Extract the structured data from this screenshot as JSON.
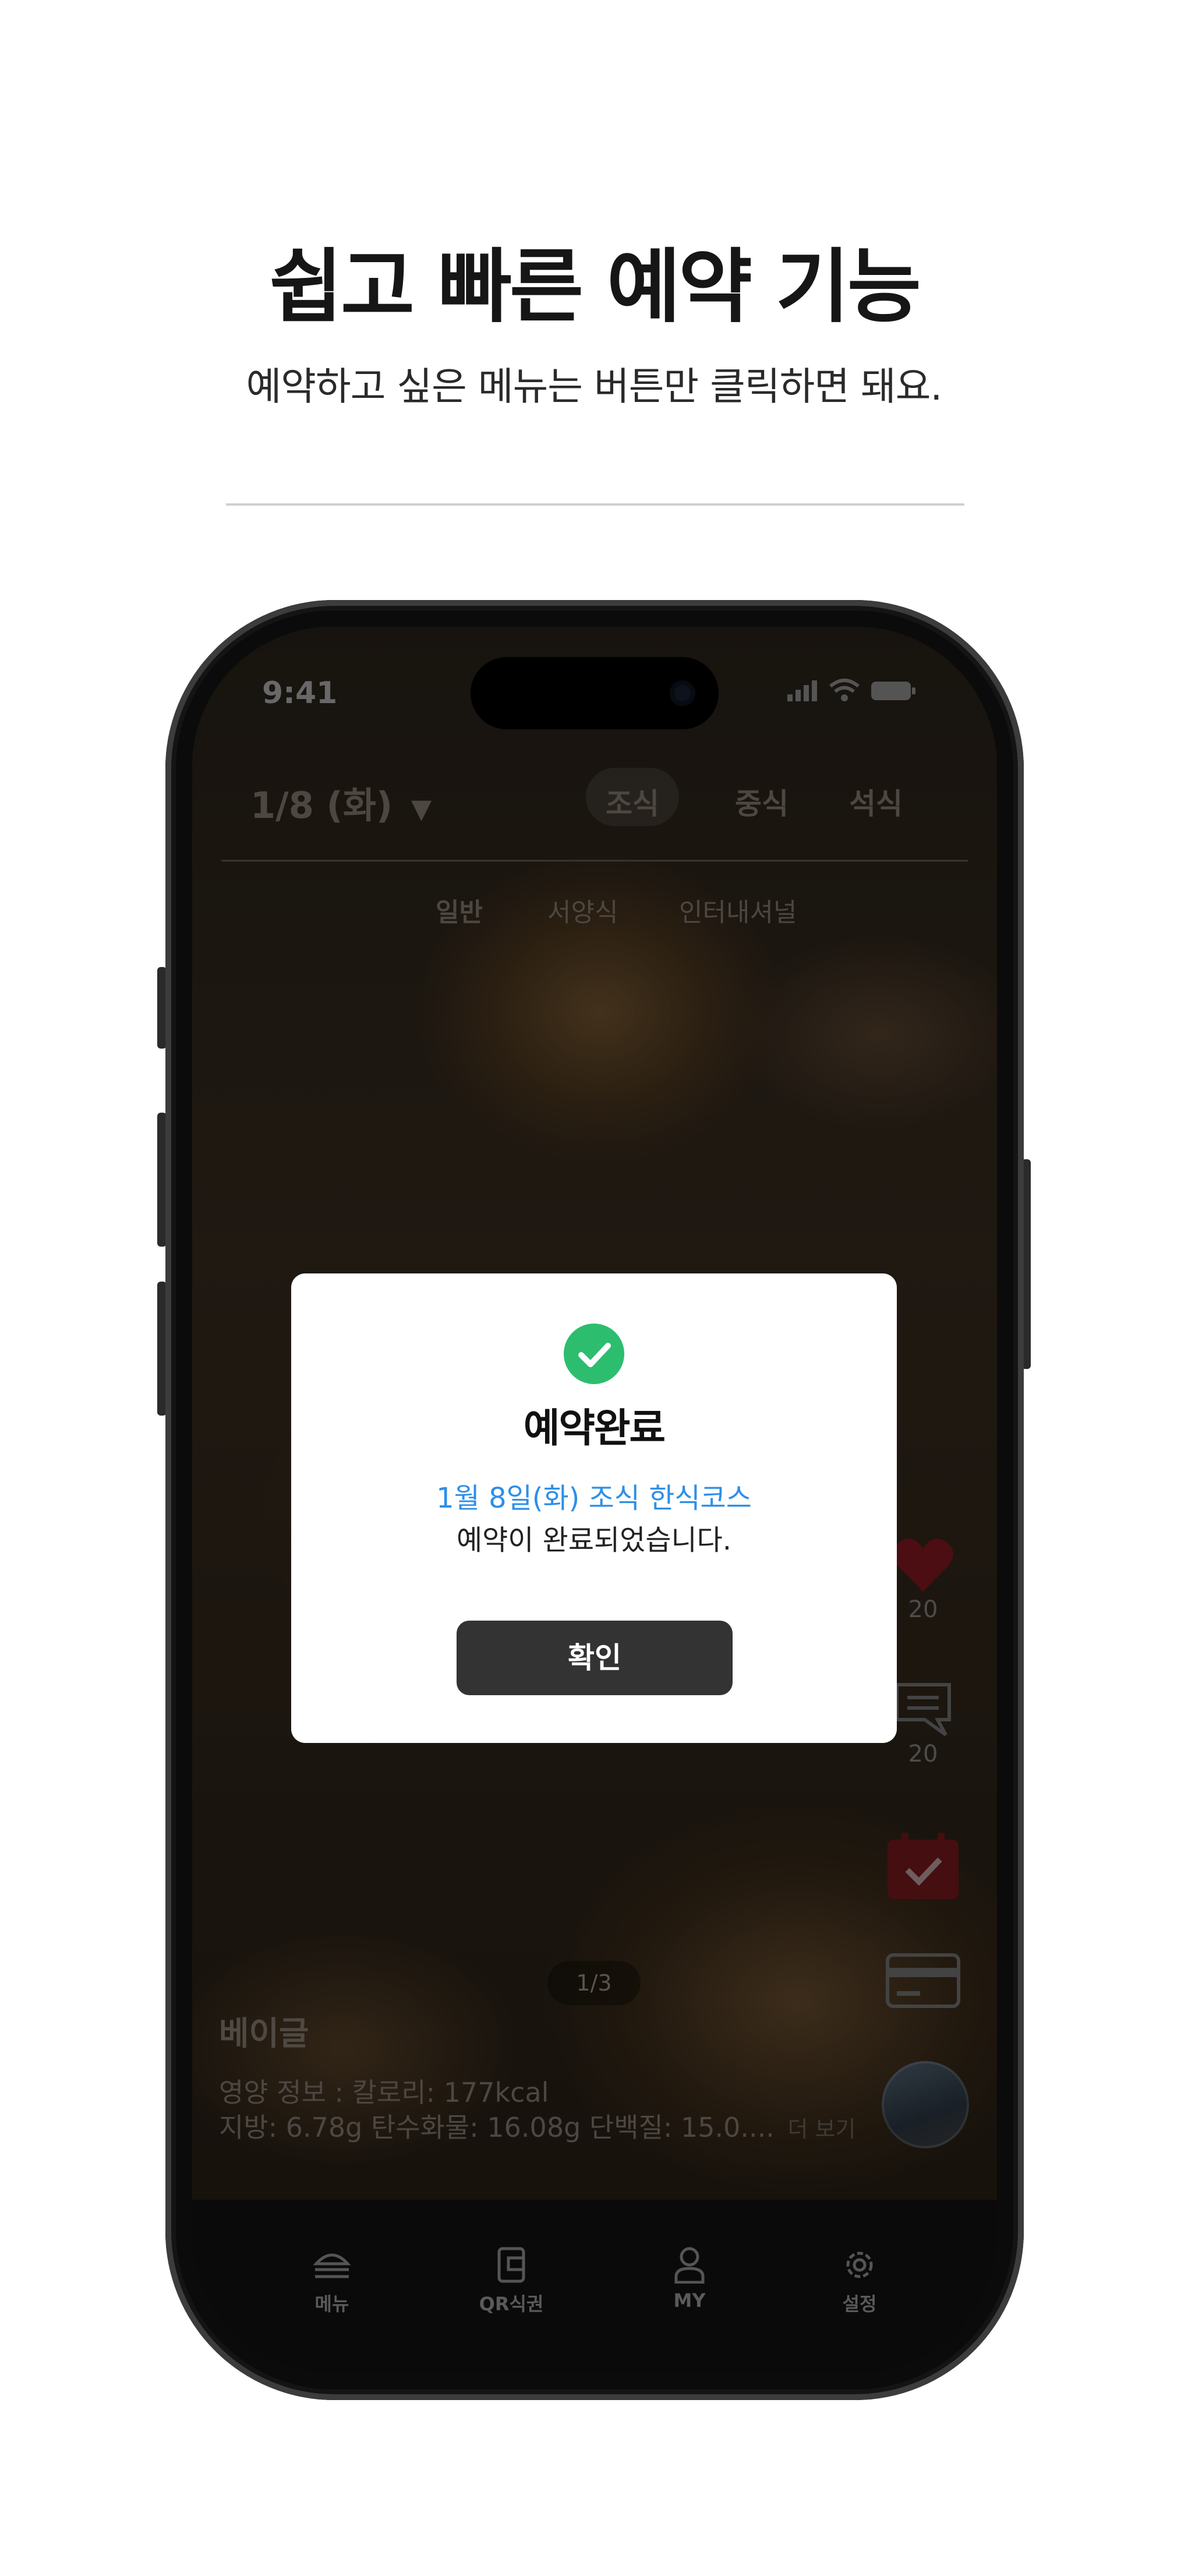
{
  "promo": {
    "headline": "쉽고 빠른 예약 기능",
    "subheadline": "예약하고 싶은 메뉴는 버튼만 클릭하면 돼요."
  },
  "status_bar": {
    "time": "9:41"
  },
  "menu_header": {
    "date": "1/8 (화)",
    "meal_tabs": [
      "조식",
      "중식",
      "석식"
    ],
    "selected_meal": "조식",
    "sub_tabs": [
      "일반",
      "서양식",
      "인터내셔널"
    ]
  },
  "side_actions": {
    "like_count": "20",
    "comment_count": "20"
  },
  "menu_item": {
    "page_indicator": "1/3",
    "name": "베이글",
    "nutrition_line1": "영양 정보 :  칼로리: 177kcal",
    "nutrition_line2": "지방: 6.78g  탄수화물: 16.08g 단백질: 15.0....",
    "more_label": "더 보기"
  },
  "tab_bar": {
    "items": [
      "메뉴",
      "QR식권",
      "MY",
      "설정"
    ]
  },
  "dialog": {
    "title": "예약완료",
    "detail": "1월 8일(화) 조식 한식코스",
    "message": "예약이 완료되었습니다.",
    "confirm_label": "확인"
  },
  "colors": {
    "success": "#2dbd6e",
    "link": "#2d8fe8",
    "button": "#333333",
    "heart": "#b3202a"
  }
}
